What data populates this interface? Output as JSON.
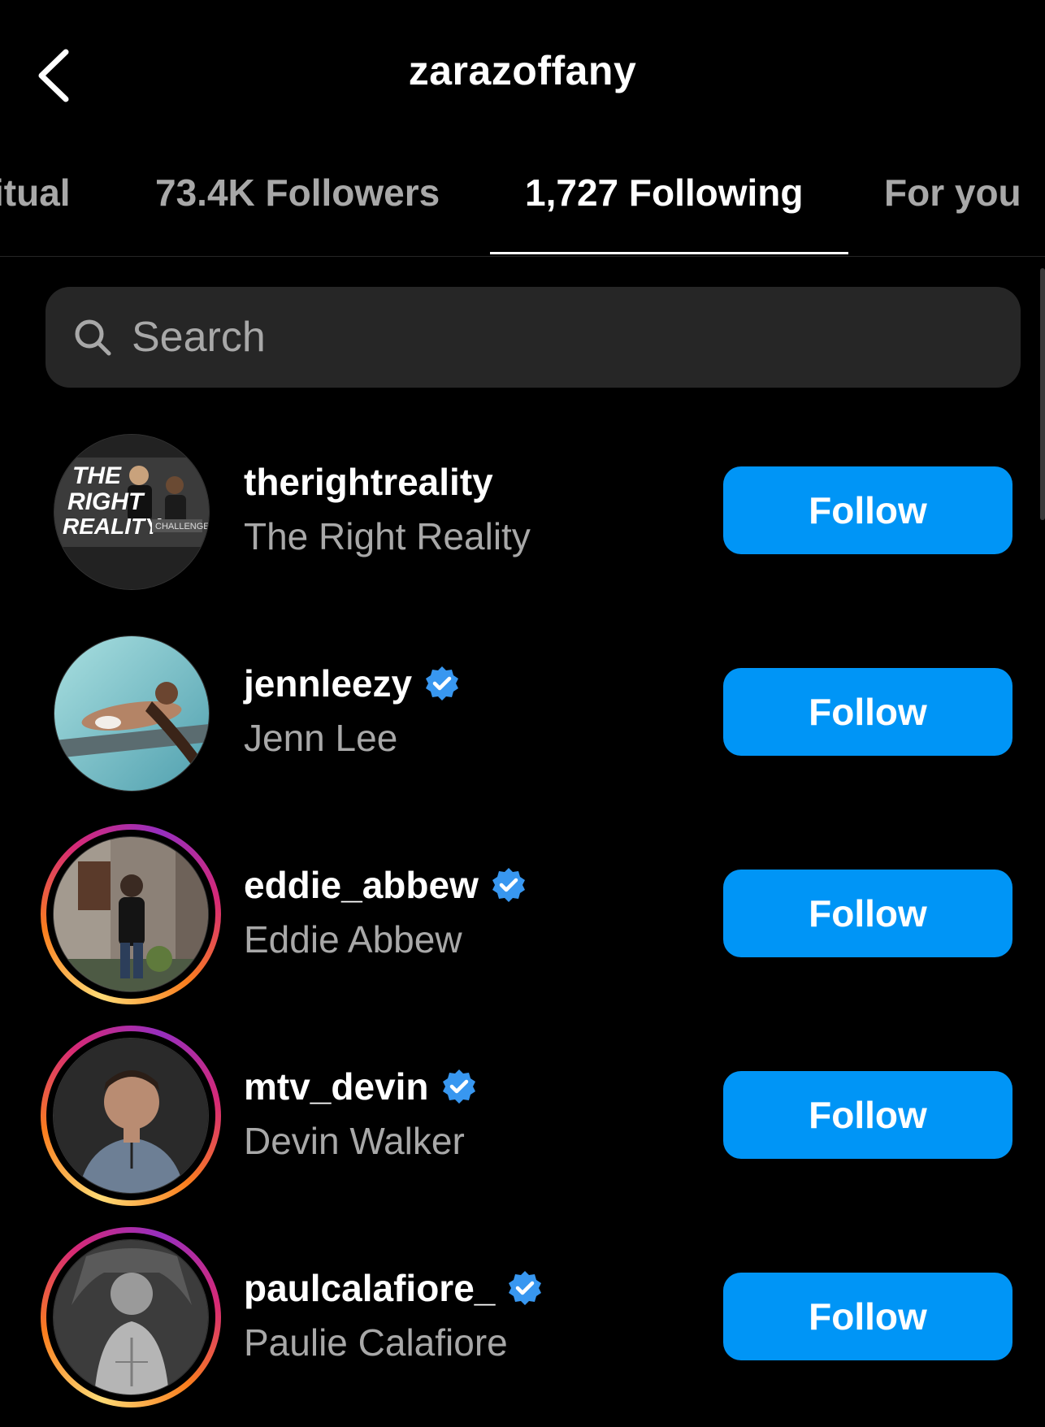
{
  "header": {
    "title": "zarazoffany",
    "back_icon": "chevron-left-icon"
  },
  "tabs": [
    {
      "label": "Mutual",
      "visible_text": "itual",
      "active": false
    },
    {
      "label": "73.4K Followers",
      "active": false
    },
    {
      "label": "1,727 Following",
      "active": true
    },
    {
      "label": "For you",
      "active": false
    }
  ],
  "search": {
    "placeholder": "Search",
    "icon": "search-icon"
  },
  "colors": {
    "background": "#000000",
    "search_bg": "#262626",
    "secondary_text": "#a8a8a8",
    "follow_button": "#0095f6",
    "verified_badge": "#3897f0"
  },
  "accounts": [
    {
      "username": "therightreality",
      "name": "The Right Reality",
      "verified": false,
      "story_ring": false,
      "button": "Follow",
      "avatar_text": [
        "THE",
        "RIGHT",
        "REALITY",
        "CHALLENGE"
      ]
    },
    {
      "username": "jennleezy",
      "name": "Jenn Lee",
      "verified": true,
      "story_ring": false,
      "button": "Follow"
    },
    {
      "username": "eddie_abbew",
      "name": "Eddie Abbew",
      "verified": true,
      "story_ring": true,
      "button": "Follow"
    },
    {
      "username": "mtv_devin",
      "name": "Devin Walker",
      "verified": true,
      "story_ring": true,
      "button": "Follow"
    },
    {
      "username": "paulcalafiore_",
      "name": "Paulie Calafiore",
      "verified": true,
      "story_ring": true,
      "button": "Follow"
    }
  ]
}
